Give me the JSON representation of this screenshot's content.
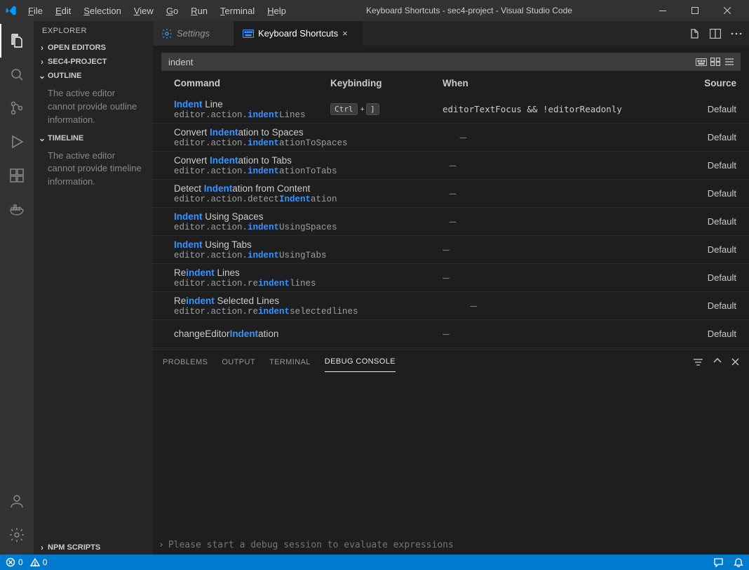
{
  "title": "Keyboard Shortcuts - sec4-project - Visual Studio Code",
  "menu": [
    "File",
    "Edit",
    "Selection",
    "View",
    "Go",
    "Run",
    "Terminal",
    "Help"
  ],
  "activity": {
    "icons": [
      "files",
      "search",
      "scm",
      "debug",
      "extensions",
      "docker"
    ],
    "bottom": [
      "account",
      "settings"
    ]
  },
  "sidebar": {
    "title": "EXPLORER",
    "sections": {
      "openEditors": "OPEN EDITORS",
      "project": "SEC4-PROJECT",
      "outline": "OUTLINE",
      "timeline": "TIMELINE",
      "npm": "NPM SCRIPTS"
    },
    "outlineMsg": "The active editor cannot provide outline information.",
    "timelineMsg": "The active editor cannot provide timeline information."
  },
  "tabs": [
    {
      "label": "Settings",
      "active": false,
      "icon": "gear"
    },
    {
      "label": "Keyboard Shortcuts",
      "active": true,
      "icon": "keyboard"
    }
  ],
  "search": {
    "value": "indent"
  },
  "columns": {
    "command": "Command",
    "keybinding": "Keybinding",
    "when": "When",
    "source": "Source"
  },
  "rows": [
    {
      "title_pre": "",
      "title_hl": "Indent",
      "title_post": " Line",
      "id_pre": "editor.action.",
      "id_hl": "indent",
      "id_post": "Lines",
      "keys": [
        "Ctrl",
        "]"
      ],
      "when": "editorTextFocus && !editorReadonly",
      "source": "Default"
    },
    {
      "title_pre": "Convert ",
      "title_hl": "Indent",
      "title_post": "ation to Spaces",
      "id_pre": "editor.action.",
      "id_hl": "indent",
      "id_post": "ationToSpaces",
      "keys": [],
      "when": "—",
      "source": "Default"
    },
    {
      "title_pre": "Convert ",
      "title_hl": "Indent",
      "title_post": "ation to Tabs",
      "id_pre": "editor.action.",
      "id_hl": "indent",
      "id_post": "ationToTabs",
      "keys": [],
      "when": "—",
      "source": "Default"
    },
    {
      "title_pre": "Detect ",
      "title_hl": "Indent",
      "title_post": "ation from Content",
      "id_pre": "editor.action.detect",
      "id_hl": "Indent",
      "id_post": "ation",
      "keys": [],
      "when": "—",
      "source": "Default"
    },
    {
      "title_pre": "",
      "title_hl": "Indent",
      "title_post": " Using Spaces",
      "id_pre": "editor.action.",
      "id_hl": "indent",
      "id_post": "UsingSpaces",
      "keys": [],
      "when": "—",
      "source": "Default"
    },
    {
      "title_pre": "",
      "title_hl": "Indent",
      "title_post": " Using Tabs",
      "id_pre": "editor.action.",
      "id_hl": "indent",
      "id_post": "UsingTabs",
      "keys": [],
      "when": "—",
      "source": "Default"
    },
    {
      "title_pre": "Re",
      "title_hl": "indent",
      "title_post": " Lines",
      "id_pre": "editor.action.re",
      "id_hl": "indent",
      "id_post": "lines",
      "keys": [],
      "when": "—",
      "source": "Default"
    },
    {
      "title_pre": "Re",
      "title_hl": "indent",
      "title_post": " Selected Lines",
      "id_pre": "editor.action.re",
      "id_hl": "indent",
      "id_post": "selectedlines",
      "keys": [],
      "when": "—",
      "source": "Default"
    },
    {
      "title_pre": "changeEditor",
      "title_hl": "Indent",
      "title_post": "ation",
      "id_pre": "",
      "id_hl": "",
      "id_post": "",
      "keys": [],
      "when": "—",
      "source": "Default",
      "noId": true
    }
  ],
  "panel": {
    "tabs": [
      "PROBLEMS",
      "OUTPUT",
      "TERMINAL",
      "DEBUG CONSOLE"
    ],
    "active": 3,
    "placeholder": "Please start a debug session to evaluate expressions"
  },
  "statusbar": {
    "errors": "0",
    "warnings": "0"
  }
}
